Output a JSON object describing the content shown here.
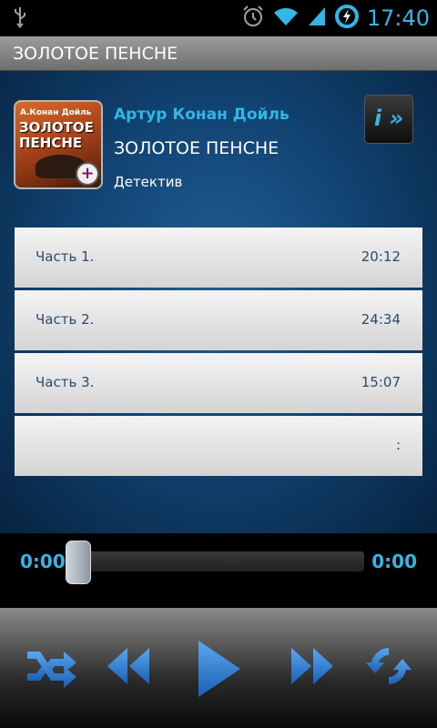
{
  "status_bar": {
    "time": "17:40",
    "icons": [
      "usb-icon",
      "alarm-icon",
      "wifi-icon",
      "signal-icon",
      "battery-charging-icon"
    ]
  },
  "title_bar": {
    "title": "ЗОЛОТОЕ ПЕНСНЕ"
  },
  "book": {
    "author": "Артур Конан Дойль",
    "title": "ЗОЛОТОЕ ПЕНСНЕ",
    "genre": "Детектив",
    "cover": {
      "author_text": "А.Конан Дойль",
      "title_text": "ЗОЛОТОЕ ПЕНСНЕ"
    }
  },
  "info_button": {
    "label": "i »"
  },
  "tracks": [
    {
      "name": "Часть 1.",
      "duration": "20:12"
    },
    {
      "name": "Часть 2.",
      "duration": "24:34"
    },
    {
      "name": "Часть 3.",
      "duration": "15:07"
    },
    {
      "name": "",
      "duration": ":"
    }
  ],
  "player": {
    "current_time": "0:00",
    "total_time": "0:00",
    "progress": 0
  },
  "controls": [
    "shuffle-icon",
    "rewind-icon",
    "play-icon",
    "fast-forward-icon",
    "repeat-icon"
  ],
  "colors": {
    "accent": "#33b5e5",
    "track_text": "#2c4b6a"
  }
}
